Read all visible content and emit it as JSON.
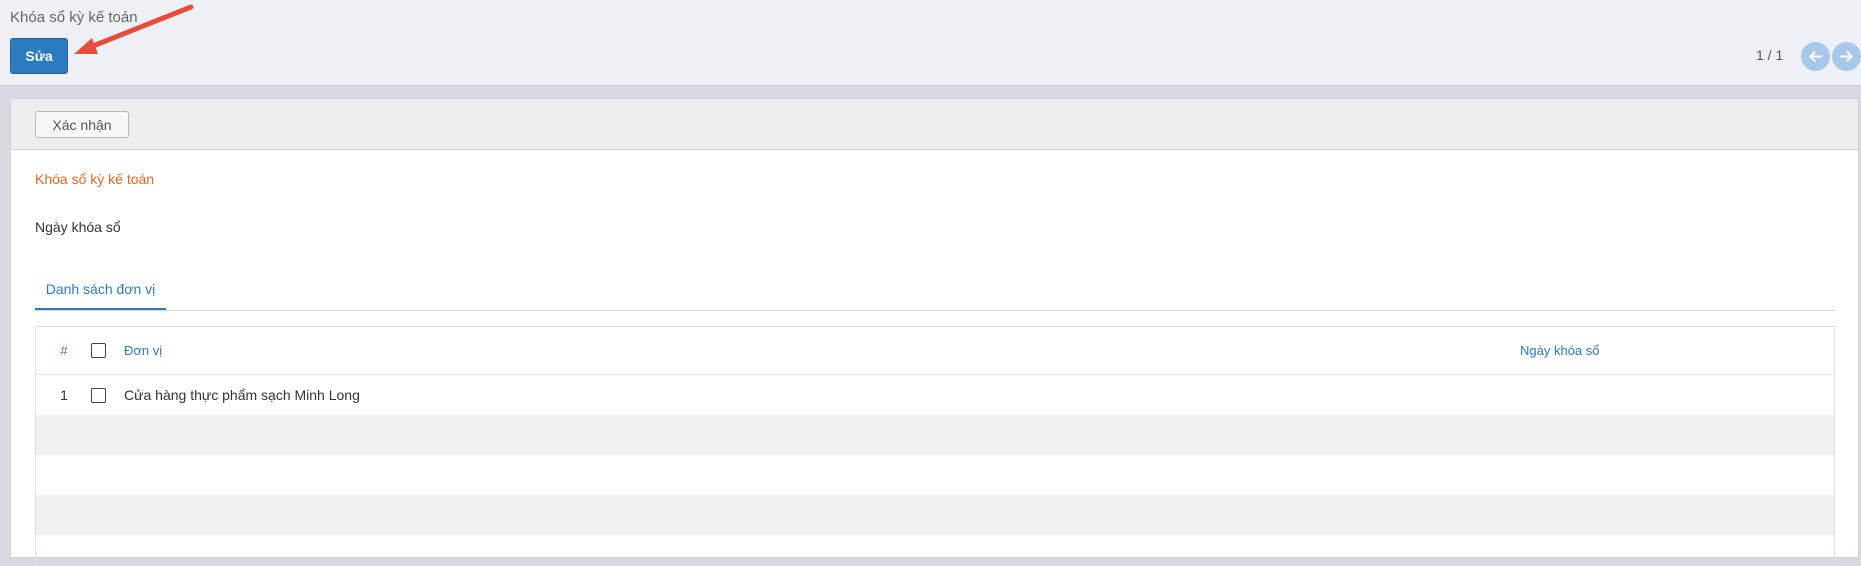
{
  "header": {
    "breadcrumb": "Khóa sổ kỳ kế toán",
    "edit_label": "Sửa",
    "pager_text": "1 / 1",
    "prev_icon": "arrow-left-icon",
    "next_icon": "arrow-right-icon"
  },
  "toolbar": {
    "confirm_label": "Xác nhận"
  },
  "form": {
    "title": "Khóa sổ kỳ kế toán",
    "closing_date_label": "Ngày khóa sổ"
  },
  "tabs": [
    {
      "label": "Danh sách đơn vị",
      "active": true
    }
  ],
  "table": {
    "headers": {
      "num": "#",
      "unit": "Đơn vị",
      "closing_date": "Ngày khóa sổ"
    },
    "rows": [
      {
        "num": "1",
        "unit": "Cửa hàng thực phẩm sạch Minh Long",
        "closing_date": ""
      }
    ]
  },
  "colors": {
    "primary": "#2c7bbf",
    "accent_title": "#e8661c",
    "annotation_arrow": "#e74c3c"
  }
}
